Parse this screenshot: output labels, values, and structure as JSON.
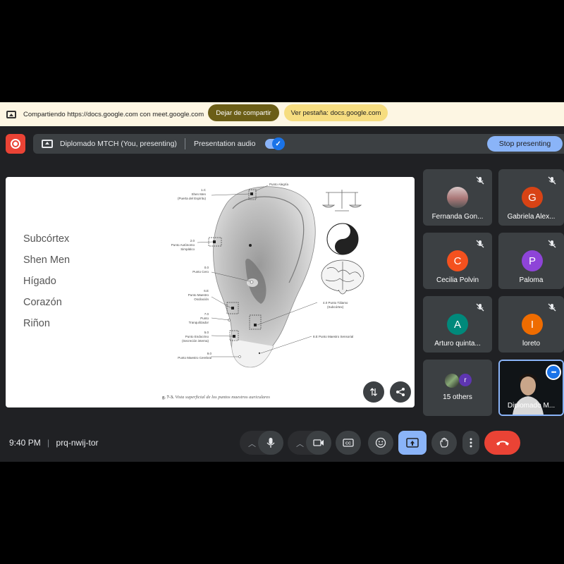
{
  "share_banner": {
    "text": "Compartiendo https://docs.google.com con meet.google.com",
    "stop_sharing_label": "Dejar de compartir",
    "view_tab_label": "Ver pestaña: docs.google.com"
  },
  "presenting_bar": {
    "title": "Diplomado MTCH (You, presenting)",
    "audio_label": "Presentation audio",
    "audio_enabled": true,
    "stop_presenting_label": "Stop presenting"
  },
  "slide": {
    "items": [
      "Subcórtex",
      "Shen Men",
      "Hígado",
      "Corazón",
      "Riñon"
    ],
    "figure": {
      "labels": {
        "shen_men": "1.C\nShen Men\n(Puerta del Espíritu)",
        "alegria": "Punto Alegría",
        "autonomo": "2.0\nPunto Autónomo\nSimpático",
        "cero": "0.0\nPunto Cero",
        "oscilacion": "6.E\nPunto Maestro\nOscilación",
        "tranquilizador": "7.0\nPunto\nTranquilizador",
        "endocrino": "5.0\nPunto Endocrino\n(Secreción interna)",
        "cerebral": "9.0\nPunto Maestro Cerebral",
        "talamo": "4.0 Punto Tálamo\n(Subcórtex)",
        "sensorial": "8.E Punto Maestro Sensorial"
      },
      "caption_bold": "g. 7-3.",
      "caption_text": "Vista superficial de los puntos maestros auriculares"
    }
  },
  "participants": [
    {
      "name": "Fernanda Gon...",
      "avatar_type": "photo",
      "muted": true
    },
    {
      "name": "Gabriela Alex...",
      "initial": "G",
      "color": "#d84315",
      "muted": true
    },
    {
      "name": "Cecilia Polvin",
      "initial": "C",
      "color": "#f4511e",
      "muted": true
    },
    {
      "name": "Paloma",
      "initial": "P",
      "color": "#8e44d8",
      "muted": true
    },
    {
      "name": "Arturo quinta...",
      "initial": "A",
      "color": "#00897b",
      "muted": true
    },
    {
      "name": "loreto",
      "initial": "I",
      "color": "#ef6c00",
      "muted": true
    },
    {
      "name": "15 others",
      "initial": "r",
      "color": "#5e35b1"
    },
    {
      "name": "Diplomado M..."
    }
  ],
  "footer": {
    "time": "9:40 PM",
    "meeting_code": "prq-nwij-tor"
  }
}
